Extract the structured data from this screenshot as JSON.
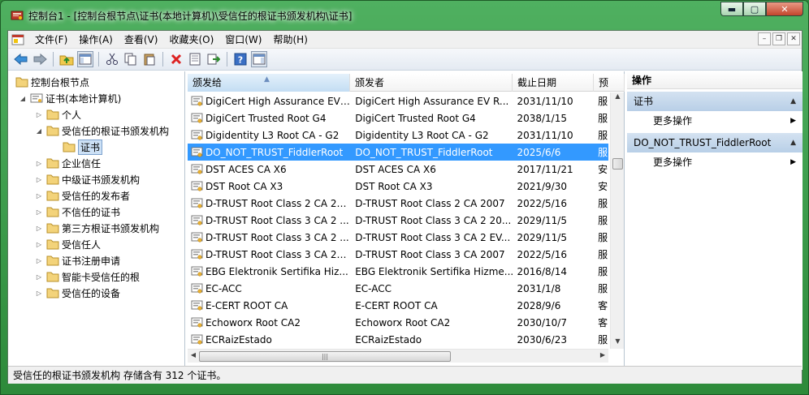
{
  "window": {
    "title": "控制台1 - [控制台根节点\\证书(本地计算机)\\受信任的根证书颁发机构\\证书]",
    "minimize_label": "▬",
    "maximize_label": "▢",
    "close_label": "✕"
  },
  "menu": {
    "items": [
      "文件(F)",
      "操作(A)",
      "查看(V)",
      "收藏夹(O)",
      "窗口(W)",
      "帮助(H)"
    ],
    "mdi_minimize": "–",
    "mdi_restore": "❐",
    "mdi_close": "✕"
  },
  "toolbar": {
    "icons": [
      "back-icon",
      "forward-icon",
      "up-folder-icon",
      "show-hide-tree-icon",
      "cut-icon",
      "copy-icon",
      "paste-icon",
      "delete-icon",
      "properties-icon",
      "export-icon",
      "help-icon",
      "show-hide-action-pane-icon"
    ]
  },
  "tree": {
    "root": "控制台根节点",
    "cert_store": "证书(本地计算机)",
    "items": [
      {
        "label": "个人",
        "expanded": false
      },
      {
        "label": "受信任的根证书颁发机构",
        "expanded": true
      },
      {
        "label": "证书",
        "selected": true
      },
      {
        "label": "企业信任",
        "expanded": false
      },
      {
        "label": "中级证书颁发机构",
        "expanded": false
      },
      {
        "label": "受信任的发布者",
        "expanded": false
      },
      {
        "label": "不信任的证书",
        "expanded": false
      },
      {
        "label": "第三方根证书颁发机构",
        "expanded": false
      },
      {
        "label": "受信任人",
        "expanded": false
      },
      {
        "label": "证书注册申请",
        "expanded": false
      },
      {
        "label": "智能卡受信任的根",
        "expanded": false
      },
      {
        "label": "受信任的设备",
        "expanded": false
      }
    ]
  },
  "list": {
    "columns": [
      "颁发给",
      "颁发者",
      "截止日期",
      "预"
    ],
    "rows": [
      {
        "issued_to": "DigiCert High Assurance EV ...",
        "issued_by": "DigiCert High Assurance EV R...",
        "expires": "2031/11/10",
        "purpose": "服"
      },
      {
        "issued_to": "DigiCert Trusted Root G4",
        "issued_by": "DigiCert Trusted Root G4",
        "expires": "2038/1/15",
        "purpose": "服"
      },
      {
        "issued_to": "Digidentity L3 Root CA - G2",
        "issued_by": "Digidentity L3 Root CA - G2",
        "expires": "2031/11/10",
        "purpose": "服"
      },
      {
        "issued_to": "DO_NOT_TRUST_FiddlerRoot",
        "issued_by": "DO_NOT_TRUST_FiddlerRoot",
        "expires": "2025/6/6",
        "purpose": "服",
        "selected": true
      },
      {
        "issued_to": "DST ACES CA X6",
        "issued_by": "DST ACES CA X6",
        "expires": "2017/11/21",
        "purpose": "安"
      },
      {
        "issued_to": "DST Root CA X3",
        "issued_by": "DST Root CA X3",
        "expires": "2021/9/30",
        "purpose": "安"
      },
      {
        "issued_to": "D-TRUST Root Class 2 CA 20...",
        "issued_by": "D-TRUST Root Class 2 CA 2007",
        "expires": "2022/5/16",
        "purpose": "服"
      },
      {
        "issued_to": "D-TRUST Root Class 3 CA 2 ...",
        "issued_by": "D-TRUST Root Class 3 CA 2 20...",
        "expires": "2029/11/5",
        "purpose": "服"
      },
      {
        "issued_to": "D-TRUST Root Class 3 CA 2 ...",
        "issued_by": "D-TRUST Root Class 3 CA 2 EV...",
        "expires": "2029/11/5",
        "purpose": "服"
      },
      {
        "issued_to": "D-TRUST Root Class 3 CA 20...",
        "issued_by": "D-TRUST Root Class 3 CA 2007",
        "expires": "2022/5/16",
        "purpose": "服"
      },
      {
        "issued_to": "EBG Elektronik Sertifika Hiz...",
        "issued_by": "EBG Elektronik Sertifika Hizme...",
        "expires": "2016/8/14",
        "purpose": "服"
      },
      {
        "issued_to": "EC-ACC",
        "issued_by": "EC-ACC",
        "expires": "2031/1/8",
        "purpose": "服"
      },
      {
        "issued_to": "E-CERT ROOT CA",
        "issued_by": "E-CERT ROOT CA",
        "expires": "2028/9/6",
        "purpose": "客"
      },
      {
        "issued_to": "Echoworx Root CA2",
        "issued_by": "Echoworx Root CA2",
        "expires": "2030/10/7",
        "purpose": "客"
      },
      {
        "issued_to": "ECRaizEstado",
        "issued_by": "ECRaizEstado",
        "expires": "2030/6/23",
        "purpose": "服"
      }
    ],
    "hscroll_grip": "|||"
  },
  "actions": {
    "title": "操作",
    "sections": [
      {
        "header": "证书",
        "items": [
          "更多操作"
        ]
      },
      {
        "header": "DO_NOT_TRUST_FiddlerRoot",
        "items": [
          "更多操作"
        ]
      }
    ]
  },
  "status": {
    "text": "受信任的根证书颁发机构 存储含有 312 个证书。"
  },
  "colors": {
    "title_gradient_top": "#4fb060",
    "selection": "#3399ff",
    "action_section": "#c5d8ec"
  }
}
